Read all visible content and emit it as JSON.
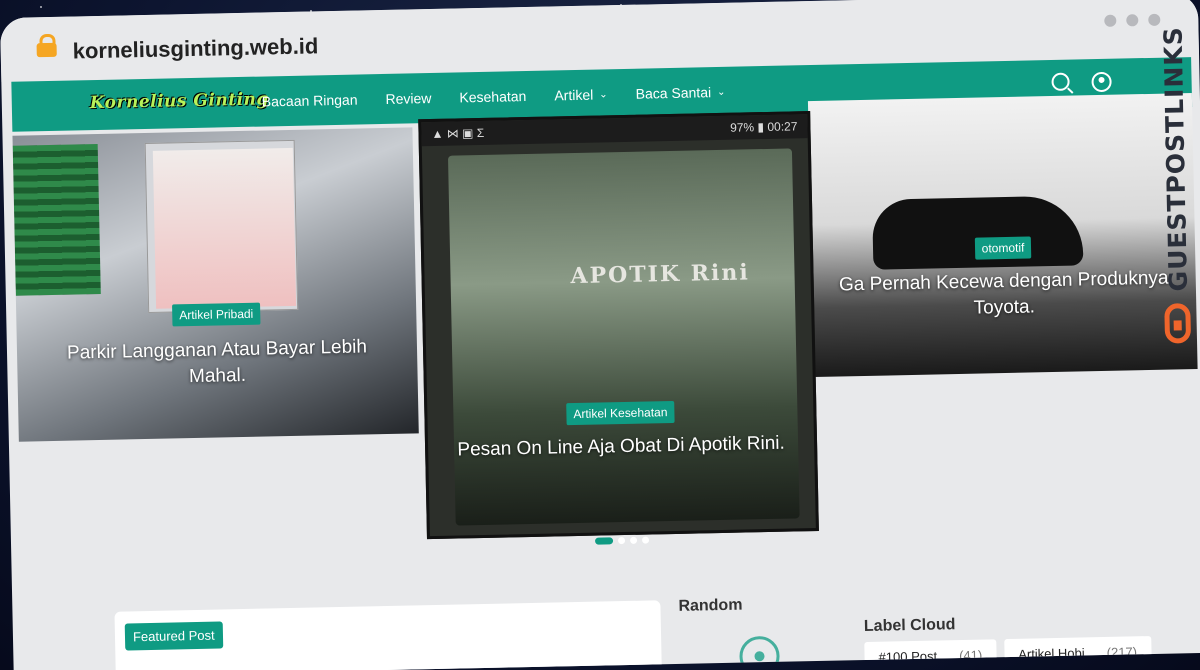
{
  "browser": {
    "url": "korneliusginting.web.id"
  },
  "nav": {
    "logo": "Kornelius Ginting",
    "items": [
      {
        "label": "Bacaan Ringan",
        "has_dropdown": false
      },
      {
        "label": "Review",
        "has_dropdown": false
      },
      {
        "label": "Kesehatan",
        "has_dropdown": false
      },
      {
        "label": "Artikel",
        "has_dropdown": true
      },
      {
        "label": "Baca Santai",
        "has_dropdown": true
      }
    ],
    "icons": [
      "search-icon",
      "user-icon"
    ],
    "color": "#0f9b83"
  },
  "slides": [
    {
      "tag": "Artikel Pribadi",
      "title": "Parkir Langganan Atau Bayar Lebih Mahal."
    },
    {
      "tag": "Artikel Kesehatan",
      "title": "Pesan On Line Aja Obat Di Apotik Rini."
    },
    {
      "tag": "otomotif",
      "title": "Ga Pernah Kecewa dengan Produknya Toyota."
    }
  ],
  "slide_center_status": {
    "left": "▲ ⋈ ▣ Σ",
    "right": "97% ▮ 00:27"
  },
  "slide_center_sign": "APOTIK Rini",
  "pager": {
    "count": 4,
    "active": 1
  },
  "featured": {
    "label": "Featured Post"
  },
  "random": {
    "title": "Random"
  },
  "label_cloud": {
    "title": "Label Cloud",
    "labels": [
      {
        "name": "#100 Post",
        "count": "(41)"
      },
      {
        "name": "Artikel Hobi",
        "count": "(217)"
      }
    ]
  },
  "watermark": {
    "text": "GUESTPOSTLINKS",
    "accent": "#f0652b"
  }
}
